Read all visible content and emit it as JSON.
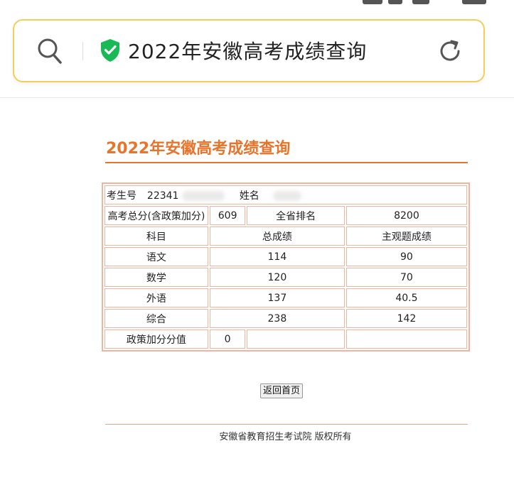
{
  "browser": {
    "address_title": "2022年安徽高考成绩查询"
  },
  "page": {
    "heading": "2022年安徽高考成绩查询",
    "table": {
      "exam_id_label": "考生号",
      "exam_id_value": "22341",
      "name_label": "姓名",
      "total_label": "高考总分(含政策加分)",
      "total_value": "609",
      "rank_label": "全省排名",
      "rank_value": "8200",
      "header": {
        "subject": "科目",
        "total_score": "总成绩",
        "subjective_score": "主观题成绩"
      },
      "rows": [
        {
          "subject": "语文",
          "total": "114",
          "subjective": "90"
        },
        {
          "subject": "数学",
          "total": "120",
          "subjective": "70"
        },
        {
          "subject": "外语",
          "total": "137",
          "subjective": "40.5"
        },
        {
          "subject": "综合",
          "total": "238",
          "subjective": "142"
        }
      ],
      "bonus_label": "政策加分分值",
      "bonus_value": "0"
    },
    "back_button": "返回首页",
    "footer": "安徽省教育招生考试院 版权所有"
  },
  "colors": {
    "accent": "#e8742b",
    "table_border": "#f3b49d",
    "address_border": "#f2cf5a",
    "shield": "#19b955"
  },
  "icons": [
    "search-icon",
    "shield-check-icon",
    "reload-icon"
  ]
}
